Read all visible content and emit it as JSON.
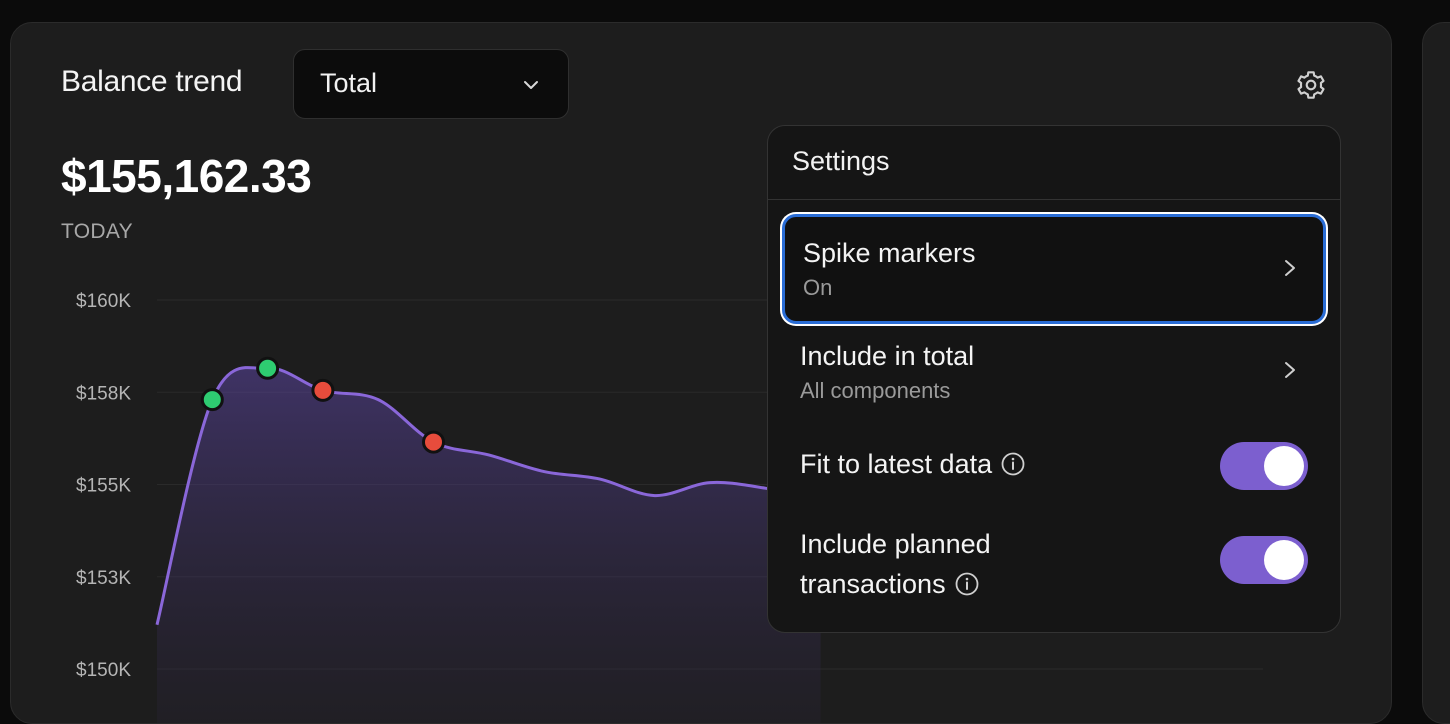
{
  "widget": {
    "title": "Balance trend",
    "dropdown_value": "Total",
    "gear_icon": "gear-icon",
    "balance": "$155,162.33",
    "balance_caption": "TODAY"
  },
  "settings_popover": {
    "title": "Settings",
    "rows": [
      {
        "label": "Spike markers",
        "sub": "On",
        "type": "submenu",
        "focused": true
      },
      {
        "label": "Include in total",
        "sub": "All components",
        "type": "submenu",
        "focused": false
      },
      {
        "label": "Fit to latest data",
        "type": "toggle",
        "value": true,
        "info": true
      },
      {
        "label_line1": "Include planned",
        "label_line2": "transactions",
        "type": "toggle",
        "value": true,
        "info": true
      }
    ]
  },
  "colors": {
    "accent": "#7c5fcf",
    "line": "#8a67d9",
    "spike_up": "#2ecc71",
    "spike_down": "#e74c3c",
    "focus_ring": "#2a6dd6",
    "card_bg": "#1d1d1d"
  },
  "chart_data": {
    "type": "area",
    "ytick_labels": [
      "$160K",
      "$158K",
      "$155K",
      "$153K",
      "$150K"
    ],
    "ylim": [
      150000,
      160000
    ],
    "grid": true,
    "x": [
      0,
      1,
      2,
      3,
      4,
      5,
      6,
      7,
      8,
      9,
      10,
      11,
      12
    ],
    "series": [
      {
        "values": [
          151200,
          157300,
          158150,
          157550,
          157300,
          156150,
          155800,
          155350,
          155150,
          154700,
          155050,
          154900,
          154600
        ],
        "spike_markers": [
          {
            "x": 1,
            "y": 157300,
            "direction": "up"
          },
          {
            "x": 2,
            "y": 158150,
            "direction": "up"
          },
          {
            "x": 3,
            "y": 157550,
            "direction": "down"
          },
          {
            "x": 5,
            "y": 156150,
            "direction": "down"
          }
        ]
      }
    ]
  }
}
